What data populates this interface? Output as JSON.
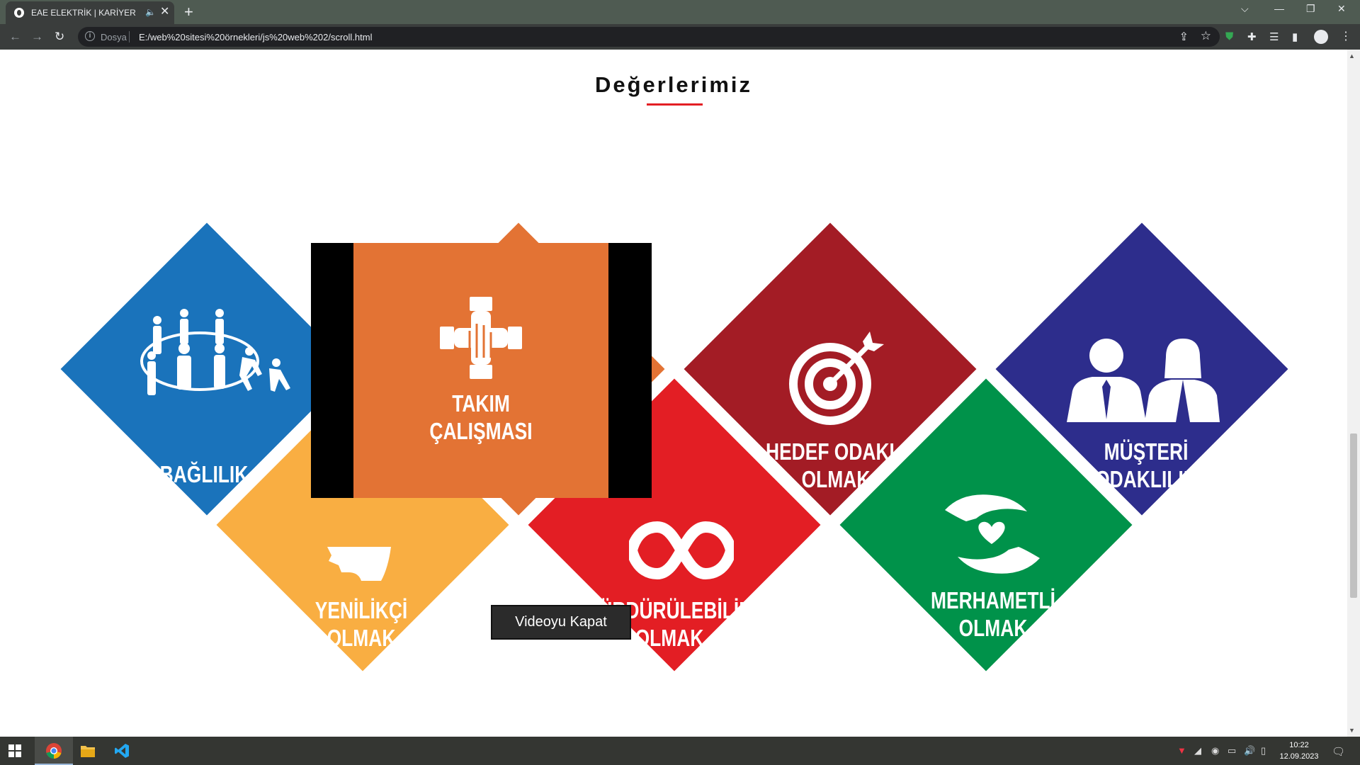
{
  "browser": {
    "tab_title": "EAE ELEKTRİK | KARİYER",
    "tab_close": "✕",
    "new_tab": "+",
    "url_scheme": "Dosya",
    "url": "E:/web%20sitesi%20örnekleri/js%20web%202/scroll.html"
  },
  "page": {
    "heading": "Değerlerimiz",
    "close_video_label": "Videoyu Kapat"
  },
  "values": [
    {
      "label": "BAĞLILIK",
      "color": "#1a73bb",
      "icon": "team-connection-icon"
    },
    {
      "label": "YENİLİKÇİ\nOLMAK",
      "color": "#f9ae42",
      "icon": "innovative-head-icon"
    },
    {
      "label": "TAKIM\nÇALIŞMASI",
      "color": "#e37334",
      "icon": "teamwork-hands-icon"
    },
    {
      "label": "SÜRDÜRÜLEBİLİR\nOLMAK",
      "color": "#e31e24",
      "icon": "infinity-icon"
    },
    {
      "label": "HEDEF ODAKLI\nOLMAK",
      "color": "#a31c25",
      "icon": "target-icon"
    },
    {
      "label": "MERHAMETLİ\nOLMAK",
      "color": "#00924a",
      "icon": "caring-hands-icon"
    },
    {
      "label": "MÜŞTERİ\nODAKLILIK",
      "color": "#2d2d8c",
      "icon": "customers-icon"
    }
  ],
  "video": {
    "color": "#e37334",
    "label": "TAKIM\nÇALIŞMASI"
  },
  "taskbar": {
    "time": "10:22",
    "date": "12.09.2023"
  }
}
